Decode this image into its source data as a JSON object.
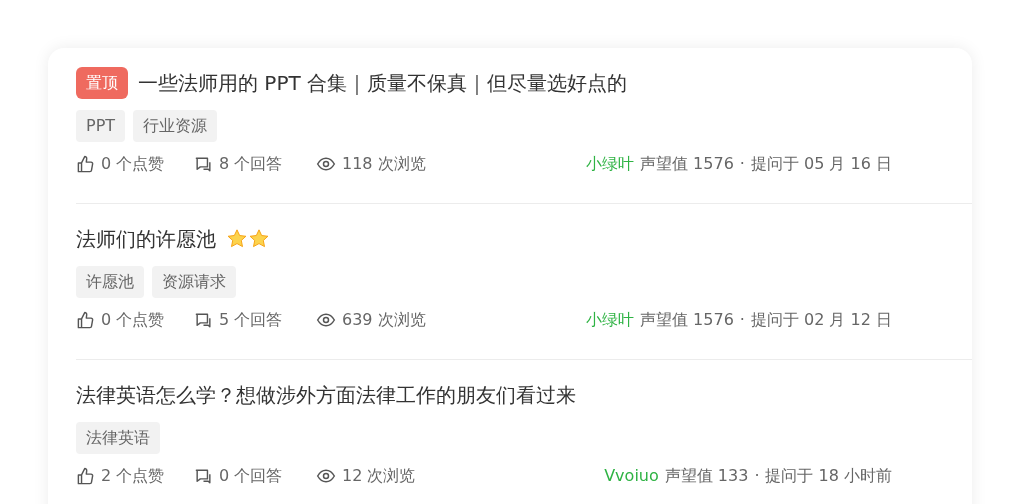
{
  "questions": [
    {
      "pinned": true,
      "pin_label": "置顶",
      "title": "一些法师用的 PPT 合集｜质量不保真｜但尽量选好点的",
      "tags": [
        "PPT",
        "行业资源"
      ],
      "likes": "0 个点赞",
      "answers": "8 个回答",
      "views": "118 次浏览",
      "author": "小绿叶",
      "reputation": "声望值 1576",
      "separator": "·",
      "time": "提问于 05 月 16 日"
    },
    {
      "pinned": false,
      "title": "法师们的许愿池",
      "title_icons": [
        {
          "kind": "star"
        },
        {
          "kind": "star"
        }
      ],
      "tags": [
        "许愿池",
        "资源请求"
      ],
      "likes": "0 个点赞",
      "answers": "5 个回答",
      "views": "639 次浏览",
      "author": "小绿叶",
      "reputation": "声望值 1576",
      "separator": "·",
      "time": "提问于 02 月 12 日"
    },
    {
      "pinned": false,
      "title": "法律英语怎么学？想做涉外方面法律工作的朋友们看过来",
      "tags": [
        "法律英语"
      ],
      "likes": "2 个点赞",
      "answers": "0 个回答",
      "views": "12 次浏览",
      "author": "Vvoiuo",
      "reputation": "声望值 133",
      "separator": "·",
      "time": "提问于 18 小时前"
    }
  ]
}
